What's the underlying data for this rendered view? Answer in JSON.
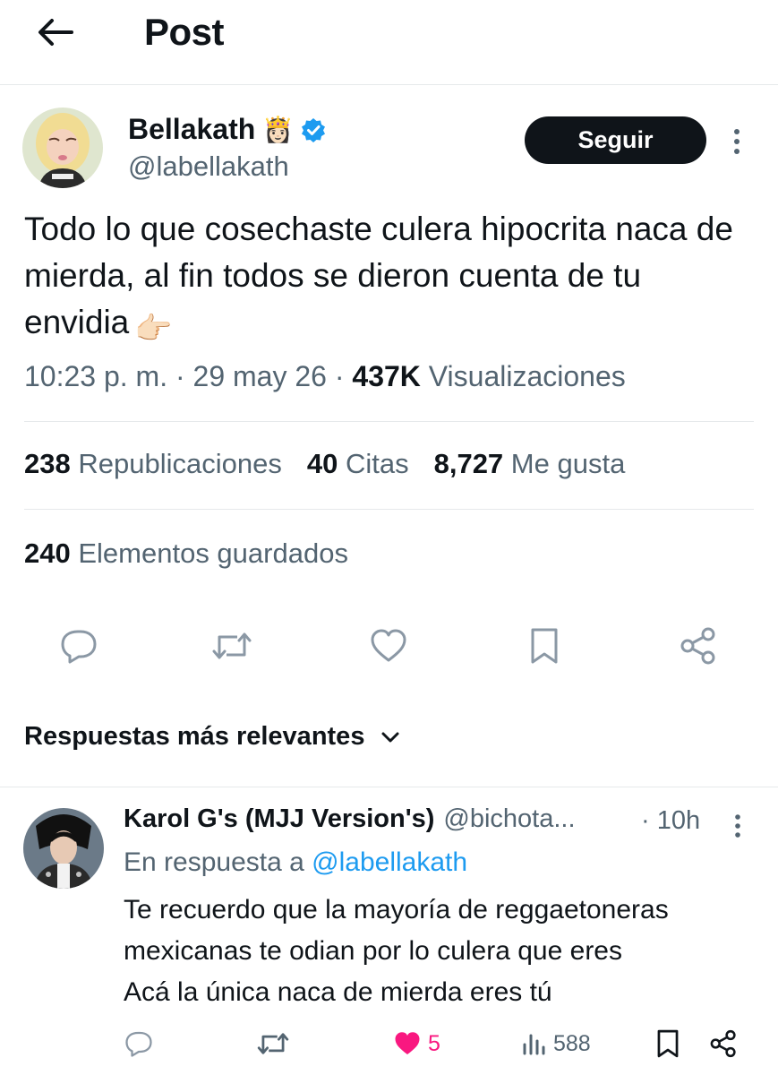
{
  "header": {
    "title": "Post"
  },
  "post": {
    "author_name": "Bellakath",
    "author_emoji": "👸🏻",
    "author_handle": "@labellakath",
    "follow_label": "Seguir",
    "text": "Todo lo que cosechaste culera hipocrita naca de mierda, al fin todos se dieron cuenta de tu envidia",
    "text_emoji": "👉🏻",
    "time": "10:23 p. m.",
    "date": "29 may 26",
    "views_count": "437K",
    "views_label": "Visualizaciones",
    "reposts_count": "238",
    "reposts_label": "Republicaciones",
    "quotes_count": "40",
    "quotes_label": "Citas",
    "likes_count": "8,727",
    "likes_label": "Me gusta",
    "saved_count": "240",
    "saved_label": "Elementos guardados"
  },
  "replies_sort": {
    "label": "Respuestas más relevantes"
  },
  "reply": {
    "author_name": "Karol G's (MJJ Version's)",
    "author_handle": "@bichota...",
    "time": "· 10h",
    "reply_to_label": "En respuesta a",
    "reply_to_handle": "@labellakath",
    "lines": [
      "Te recuerdo que la mayoría de reggaetoneras",
      "mexicanas te odian por lo culera que eres",
      "Acá la única naca de mierda eres tú"
    ],
    "likes_count": "5",
    "views_count": "588"
  },
  "colors": {
    "text_primary": "#0f1419",
    "text_secondary": "#536471",
    "link": "#1d9bf0",
    "like_active": "#f91880",
    "verified": "#1d9bf0",
    "divider": "#e6e9eb"
  },
  "icons": {
    "back": "arrow-left-icon",
    "verified": "verified-badge-icon",
    "more": "more-vertical-icon",
    "reply": "reply-icon",
    "repost": "repost-icon",
    "like": "heart-icon",
    "bookmark": "bookmark-icon",
    "share": "share-icon",
    "views": "views-icon",
    "chevron": "chevron-down-icon"
  }
}
